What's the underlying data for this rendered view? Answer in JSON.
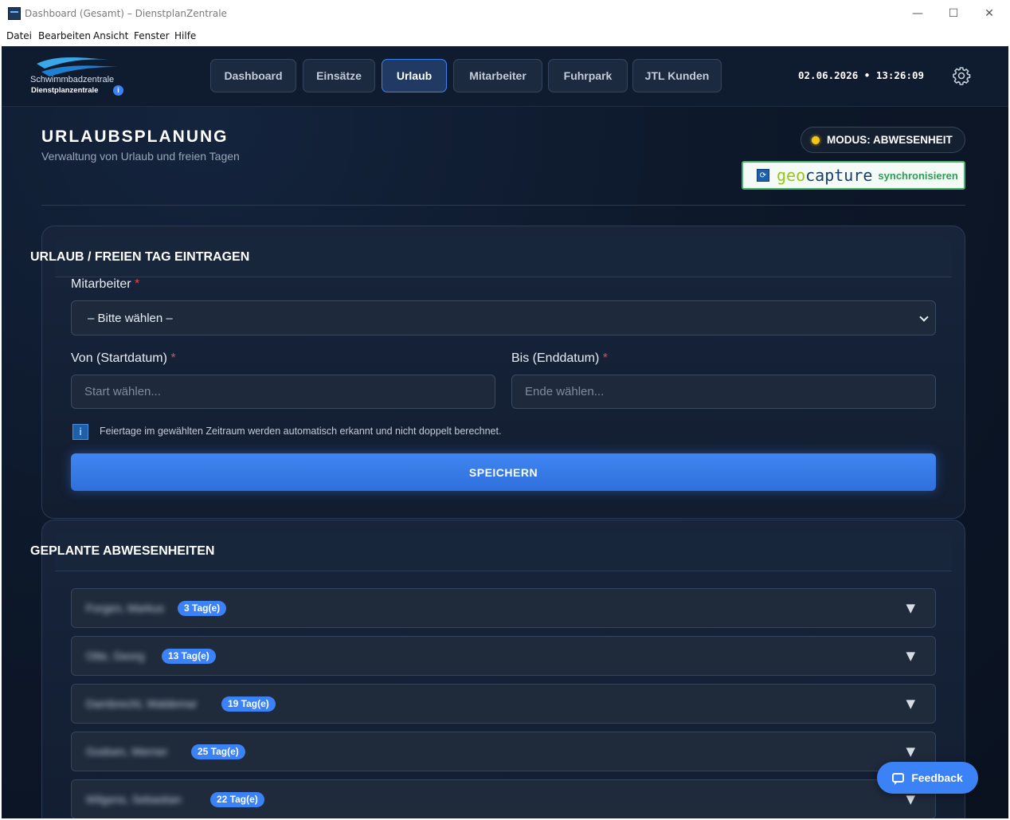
{
  "window": {
    "title": "Dashboard (Gesamt) – DienstplanZentrale",
    "minimize": "—",
    "maximize": "☐",
    "close": "✕"
  },
  "menu": [
    "Datei",
    "Bearbeiten",
    "Ansicht",
    "Fenster",
    "Hilfe"
  ],
  "logo": {
    "line1": "Schwimmbadzentrale",
    "line2": "Dienstplanzentrale",
    "info": "i"
  },
  "nav": {
    "tabs": [
      "Dashboard",
      "Einsätze",
      "Urlaub",
      "Mitarbeiter",
      "Fuhrpark",
      "JTL Kunden"
    ],
    "active": "Urlaub",
    "datetime": "02.06.2026 • 13:26:09"
  },
  "page": {
    "title": "URLAUBSPLANUNG",
    "subtitle": "Verwaltung von Urlaub und freien Tagen",
    "mode": "MODUS: ABWESENHEIT",
    "geocapture": {
      "brand_a": "geo",
      "brand_b": "capture",
      "action": "synchronisieren"
    }
  },
  "form": {
    "title": "URLAUB / FREIEN TAG EINTRAGEN",
    "employee_label": "Mitarbeiter",
    "required_mark": "*",
    "employee_value": "– Bitte wählen –",
    "from_label": "Von (Startdatum)",
    "to_label": "Bis (Enddatum)",
    "from_placeholder": "Start wählen...",
    "to_placeholder": "Ende wählen...",
    "info_icon": "i",
    "info_text": "Feiertage im gewählten Zeitraum werden automatisch erkannt und nicht doppelt berechnet.",
    "save_label": "SPEICHERN"
  },
  "absences": {
    "title": "GEPLANTE ABWESENHEITEN",
    "toggle": "▼",
    "rows": [
      {
        "name": "Forgen, Markus",
        "badge": "3 Tag(e)"
      },
      {
        "name": "Otte, Georg",
        "badge": "13 Tag(e)"
      },
      {
        "name": "Dambrecht, Waldemar",
        "badge": "19 Tag(e)"
      },
      {
        "name": "Godsen, Werner",
        "badge": "25 Tag(e)"
      },
      {
        "name": "Wilgens, Sebastian",
        "badge": "22 Tag(e)"
      }
    ]
  },
  "feedback_label": "Feedback",
  "colors": {
    "accent": "#3b82f6",
    "background": "#0d182a",
    "mode_dot": "#f5c518",
    "geocapture_green": "#49b26b"
  }
}
